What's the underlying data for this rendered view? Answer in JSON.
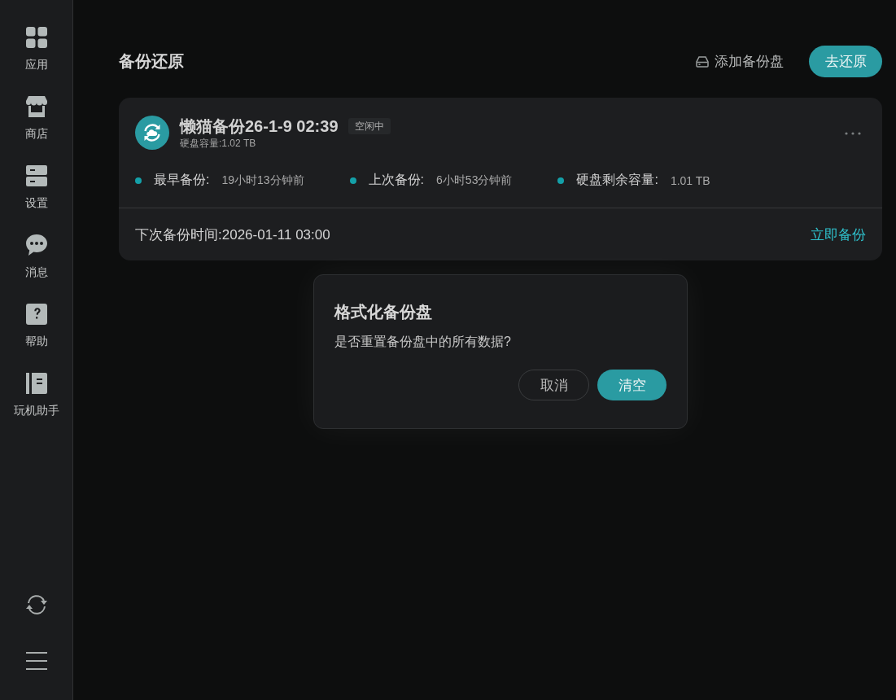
{
  "sidebar": {
    "items": [
      {
        "label": "应用",
        "selected": false
      },
      {
        "label": "商店",
        "selected": false
      },
      {
        "label": "设置",
        "selected": false
      },
      {
        "label": "消息",
        "selected": false
      },
      {
        "label": "帮助",
        "selected": false
      },
      {
        "label": "玩机助手",
        "selected": false
      }
    ]
  },
  "header": {
    "title": "备份还原",
    "add_disk": "添加备份盘",
    "restore_button": "去还原"
  },
  "backup_card": {
    "name": "懒猫备份26-1-9 02:39",
    "status": "空闲中",
    "capacity": "硬盘容量:1.02 TB",
    "stats": [
      {
        "label": "最早备份:",
        "value": "19小时13分钟前"
      },
      {
        "label": "上次备份:",
        "value": "6小时53分钟前"
      },
      {
        "label": "硬盘剩余容量:",
        "value": "1.01 TB"
      }
    ],
    "next_backup": "下次备份时间:2026-01-11 03:00",
    "backup_now": "立即备份"
  },
  "dialog": {
    "title": "格式化备份盘",
    "message": "是否重置备份盘中的所有数据?",
    "buttons": [
      {
        "label": "取消",
        "kind": "secondary"
      },
      {
        "label": "清空",
        "kind": "primary"
      }
    ]
  }
}
